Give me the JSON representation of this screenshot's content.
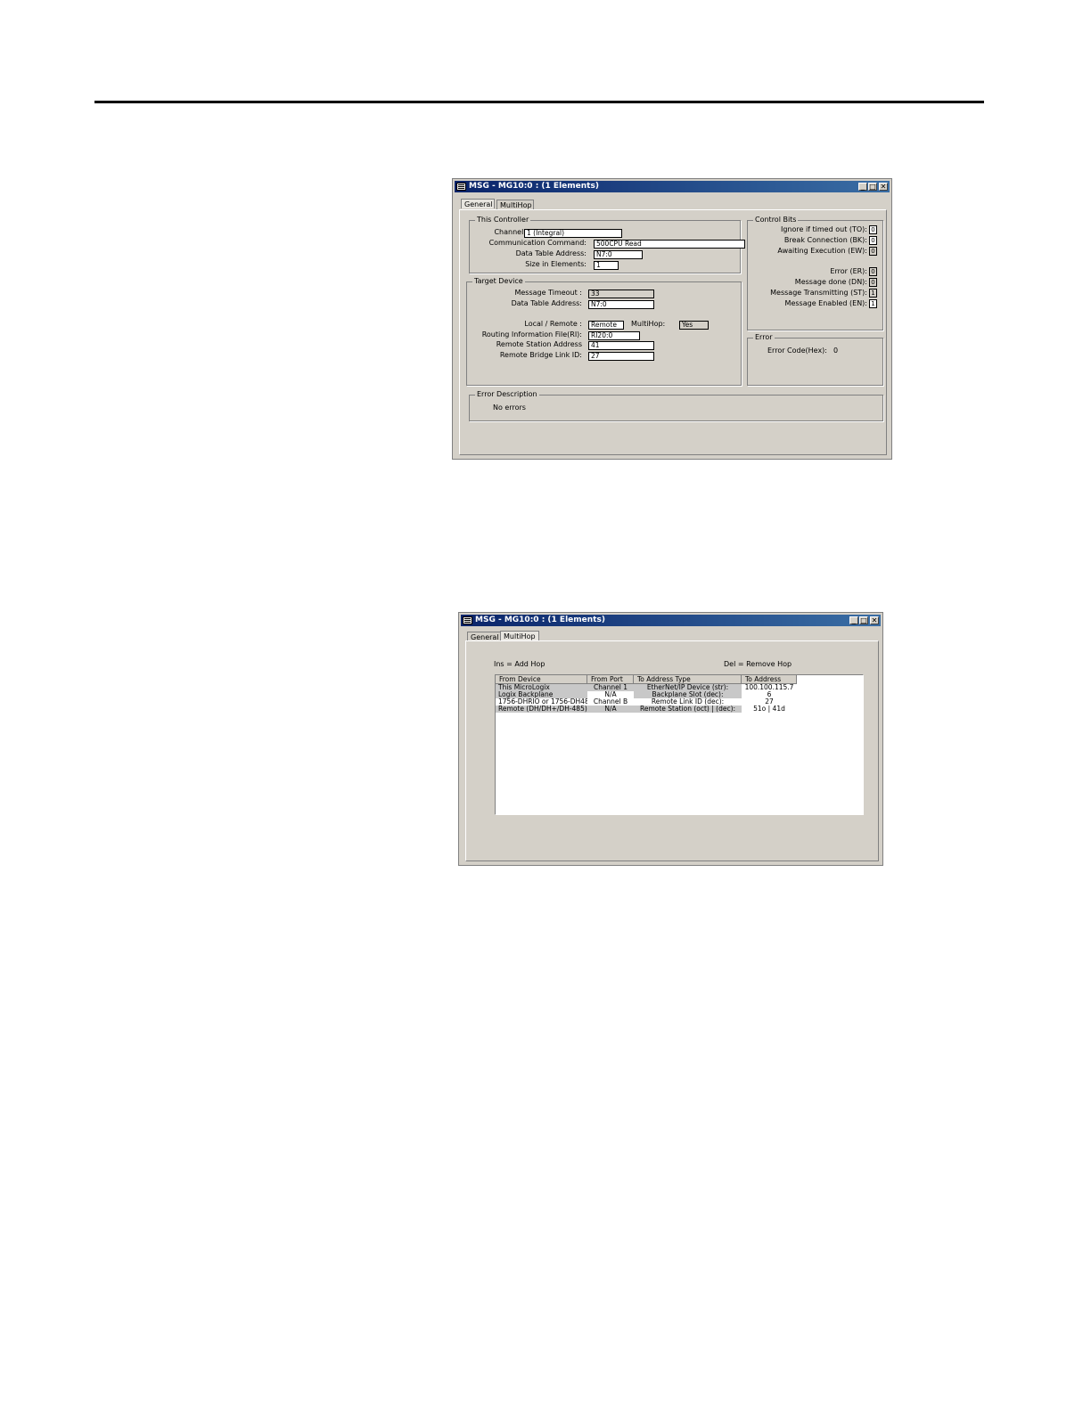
{
  "dialog1": {
    "title": "MSG - MG10:0 : (1 Elements)",
    "buttons": {
      "minimize": "_",
      "maximize": "□",
      "close": "✕"
    },
    "tabs": [
      "General",
      "MultiHop"
    ],
    "this_controller": {
      "title": "This Controller",
      "channel_label": "Channel:",
      "channel_value": "1 (Integral)",
      "comm_cmd_label": "Communication Command:",
      "comm_cmd_value": "500CPU Read",
      "data_table_label": "Data Table Address:",
      "data_table_value": "N7:0",
      "size_label": "Size in Elements:",
      "size_value": "1"
    },
    "target_device": {
      "title": "Target Device",
      "timeout_label": "Message Timeout :",
      "timeout_value": "33",
      "data_table_label": "Data Table Address:",
      "data_table_value": "N7:0",
      "local_remote_label": "Local / Remote :",
      "local_remote_value": "Remote",
      "multihop_label": "MultiHop:",
      "multihop_value": "Yes",
      "routing_label": "Routing Information File(RI):",
      "routing_value": "RI20:0",
      "station_label": "Remote Station Address",
      "station_value": "41",
      "bridge_label": "Remote Bridge Link ID:",
      "bridge_value": "27"
    },
    "control_bits": {
      "title": "Control Bits",
      "to_label": "Ignore if timed out (TO):",
      "to_value": "0",
      "bk_label": "Break Connection (BK):",
      "bk_value": "0",
      "ew_label": "Awaiting Execution (EW):",
      "ew_value": "0",
      "er_label": "Error (ER):",
      "er_value": "0",
      "dn_label": "Message done (DN):",
      "dn_value": "0",
      "st_label": "Message Transmitting (ST):",
      "st_value": "1",
      "en_label": "Message Enabled (EN):",
      "en_value": "1"
    },
    "error": {
      "title": "Error",
      "code_label": "Error Code(Hex):",
      "code_value": "0"
    },
    "error_description": {
      "title": "Error Description",
      "text": "No errors"
    }
  },
  "dialog2": {
    "title": "MSG - MG10:0 : (1 Elements)",
    "buttons": {
      "minimize": "_",
      "maximize": "□",
      "close": "✕"
    },
    "tabs": [
      "General",
      "MultiHop"
    ],
    "ins_hint": "Ins = Add Hop",
    "del_hint": "Del = Remove Hop",
    "headers": [
      "From Device",
      "From Port",
      "To Address Type",
      "To Address"
    ],
    "rows": [
      [
        "This MicroLogix",
        "Channel 1",
        "EtherNet/IP Device (str):",
        "100.100.115.7"
      ],
      [
        "Logix Backplane",
        "N/A",
        "Backplane Slot (dec):",
        "6"
      ],
      [
        "1756-DHRIO or 1756-DH485",
        "Channel B",
        "Remote Link ID (dec):",
        "27"
      ],
      [
        "Remote (DH/DH+/DH-485)",
        "N/A",
        "Remote Station (oct) | (dec):",
        "51o  |  41d"
      ]
    ]
  }
}
